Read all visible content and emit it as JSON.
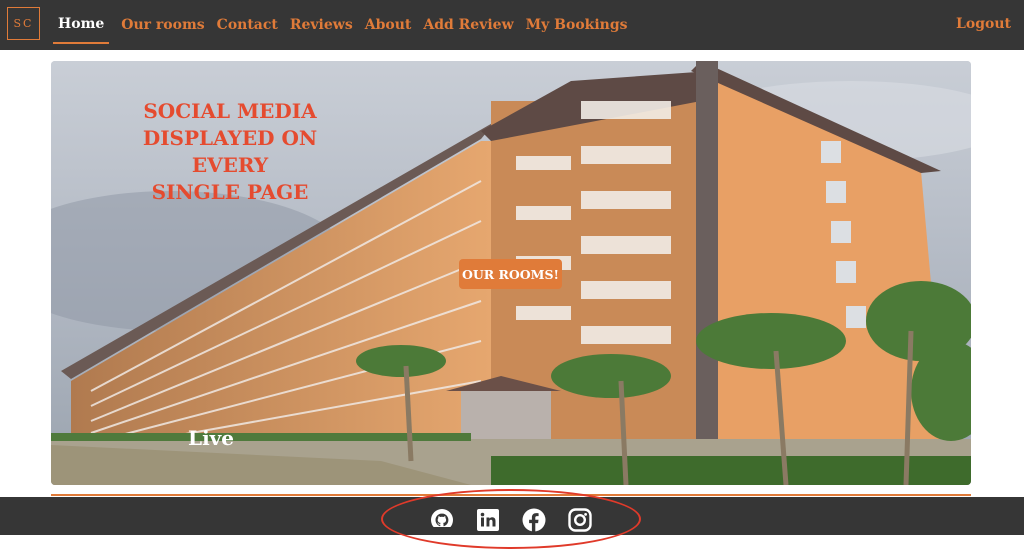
{
  "nav": {
    "logo": "SC",
    "links": [
      {
        "label": "Home"
      },
      {
        "label": "Our rooms"
      },
      {
        "label": "Contact"
      },
      {
        "label": "Reviews"
      },
      {
        "label": "About"
      },
      {
        "label": "Add Review"
      },
      {
        "label": "My Bookings"
      }
    ],
    "logout": "Logout"
  },
  "hero": {
    "caption_lines": [
      "SOCIAL MEDIA",
      "DISPLAYED ON EVERY",
      "SINGLE PAGE"
    ],
    "button": "OUR ROOMS!",
    "live": "Live"
  },
  "footer": {
    "icons": [
      "github-icon",
      "linkedin-icon",
      "facebook-icon",
      "instagram-icon"
    ]
  },
  "colors": {
    "navbar_bg": "#363636",
    "accent": "#e07b39",
    "caption": "#e54b2f",
    "annotation": "#e03a2a"
  }
}
